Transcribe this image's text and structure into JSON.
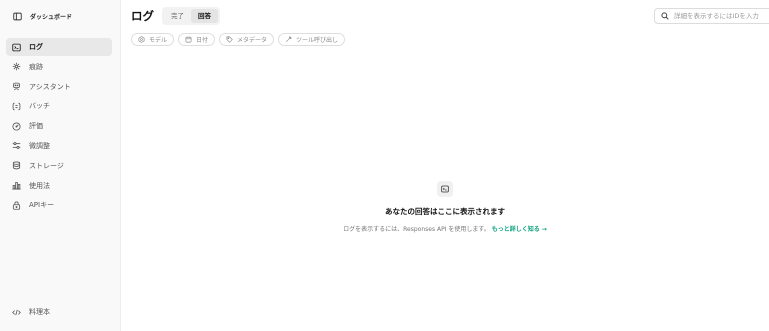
{
  "sidebar": {
    "dashboard_label": "ダッシュボード",
    "items": [
      {
        "label": "ログ",
        "icon": "terminal-icon",
        "active": true
      },
      {
        "label": "痕跡",
        "icon": "trace-icon"
      },
      {
        "label": "アシスタント",
        "icon": "assistant-icon"
      },
      {
        "label": "バッチ",
        "icon": "batch-icon"
      },
      {
        "label": "評価",
        "icon": "eval-icon"
      },
      {
        "label": "微調整",
        "icon": "finetune-icon"
      },
      {
        "label": "ストレージ",
        "icon": "storage-icon"
      },
      {
        "label": "使用法",
        "icon": "usage-icon"
      },
      {
        "label": "APIキー",
        "icon": "lock-icon"
      }
    ],
    "bottom_items": [
      {
        "label": "料理本",
        "icon": "code-icon"
      }
    ]
  },
  "header": {
    "title": "ログ",
    "tabs": [
      {
        "label": "完了",
        "active": false
      },
      {
        "label": "回答",
        "active": true
      }
    ]
  },
  "search": {
    "placeholder": "詳細を表示するにはIDを入力"
  },
  "filters": [
    {
      "label": "モデル",
      "icon": "model-icon"
    },
    {
      "label": "日付",
      "icon": "calendar-icon"
    },
    {
      "label": "メタデータ",
      "icon": "tag-icon"
    },
    {
      "label": "ツール呼び出し",
      "icon": "tool-icon"
    }
  ],
  "empty_state": {
    "title": "あなたの回答はここに表示されます",
    "description": "ログを表示するには、Responses API を使用します。",
    "link": "もっと詳しく知る →"
  },
  "colors": {
    "accent": "#10a37f",
    "sidebar_bg": "#f9f9f9",
    "active_bg": "#e8e8e8"
  }
}
